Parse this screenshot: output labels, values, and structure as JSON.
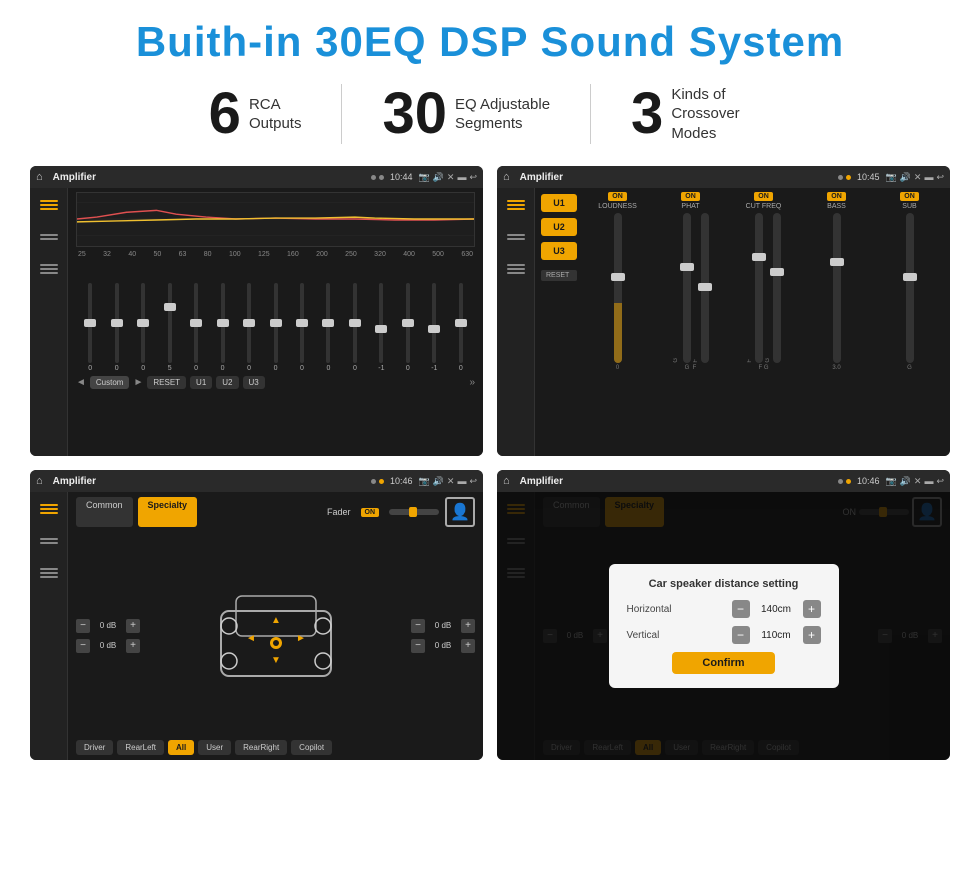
{
  "title": "Buith-in 30EQ DSP Sound System",
  "stats": [
    {
      "number": "6",
      "label": "RCA\nOutputs"
    },
    {
      "number": "30",
      "label": "EQ Adjustable\nSegments"
    },
    {
      "number": "3",
      "label": "Kinds of\nCrossover Modes"
    }
  ],
  "screens": [
    {
      "id": "eq-screen",
      "title": "Amplifier",
      "time": "10:44",
      "eq_freqs": [
        "25",
        "32",
        "40",
        "50",
        "63",
        "80",
        "100",
        "125",
        "160",
        "200",
        "250",
        "320",
        "400",
        "500",
        "630"
      ],
      "eq_values": [
        "0",
        "0",
        "0",
        "5",
        "0",
        "0",
        "0",
        "0",
        "0",
        "0",
        "0",
        "-1",
        "0",
        "-1"
      ],
      "preset": "Custom",
      "buttons": [
        "RESET",
        "U1",
        "U2",
        "U3"
      ]
    },
    {
      "id": "crossover-screen",
      "title": "Amplifier",
      "time": "10:45",
      "channels": [
        "LOUDNESS",
        "PHAT",
        "CUT FREQ",
        "BASS",
        "SUB"
      ],
      "u_buttons": [
        "U1",
        "U2",
        "U3"
      ],
      "reset_label": "RESET"
    },
    {
      "id": "fader-screen",
      "title": "Amplifier",
      "time": "10:46",
      "tabs": [
        "Common",
        "Specialty"
      ],
      "fader_label": "Fader",
      "fader_on": "ON",
      "volumes": [
        "0 dB",
        "0 dB",
        "0 dB",
        "0 dB"
      ],
      "bottom_labels": [
        "Driver",
        "RearLeft",
        "All",
        "User",
        "RearRight",
        "Copilot"
      ]
    },
    {
      "id": "dialog-screen",
      "title": "Amplifier",
      "time": "10:46",
      "tabs": [
        "Common",
        "Specialty"
      ],
      "dialog": {
        "title": "Car speaker distance setting",
        "horizontal_label": "Horizontal",
        "horizontal_value": "140cm",
        "vertical_label": "Vertical",
        "vertical_value": "110cm",
        "confirm_label": "Confirm"
      },
      "volumes": [
        "0 dB",
        "0 dB"
      ],
      "bottom_labels": [
        "Driver",
        "RearLeft",
        "All",
        "User",
        "RearRight",
        "Copilot"
      ]
    }
  ]
}
